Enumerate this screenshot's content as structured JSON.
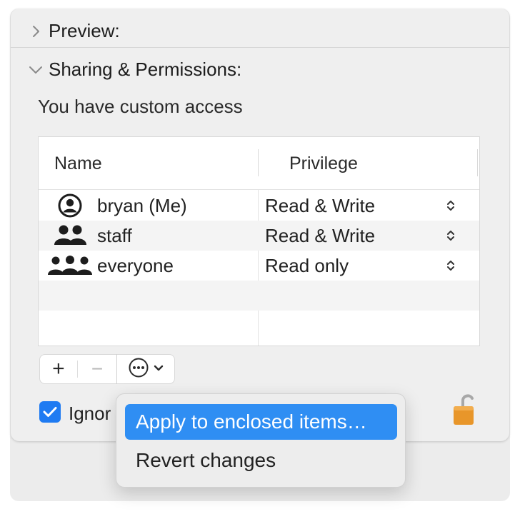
{
  "sections": {
    "preview": {
      "label": "Preview:"
    },
    "sharing": {
      "label": "Sharing & Permissions:"
    }
  },
  "access_text": "You have custom access",
  "table": {
    "headers": {
      "name": "Name",
      "privilege": "Privilege"
    },
    "rows": [
      {
        "name": "bryan (Me)",
        "privilege": "Read & Write",
        "icon": "single-user-icon"
      },
      {
        "name": "staff",
        "privilege": "Read & Write",
        "icon": "group-icon"
      },
      {
        "name": "everyone",
        "privilege": "Read only",
        "icon": "everyone-icon"
      }
    ]
  },
  "buttons": {
    "add": "+",
    "remove": "−",
    "action_icon": "ellipsis-circle-icon"
  },
  "ignore_ownership": {
    "label": "Ignor",
    "checked": true
  },
  "context_menu": {
    "items": [
      {
        "label": "Apply to enclosed items…",
        "highlighted": true
      },
      {
        "label": "Revert changes",
        "highlighted": false
      }
    ]
  },
  "colors": {
    "accent": "#2f8ef3",
    "checkbox": "#1f7bf2",
    "lock": "#e8962a"
  }
}
